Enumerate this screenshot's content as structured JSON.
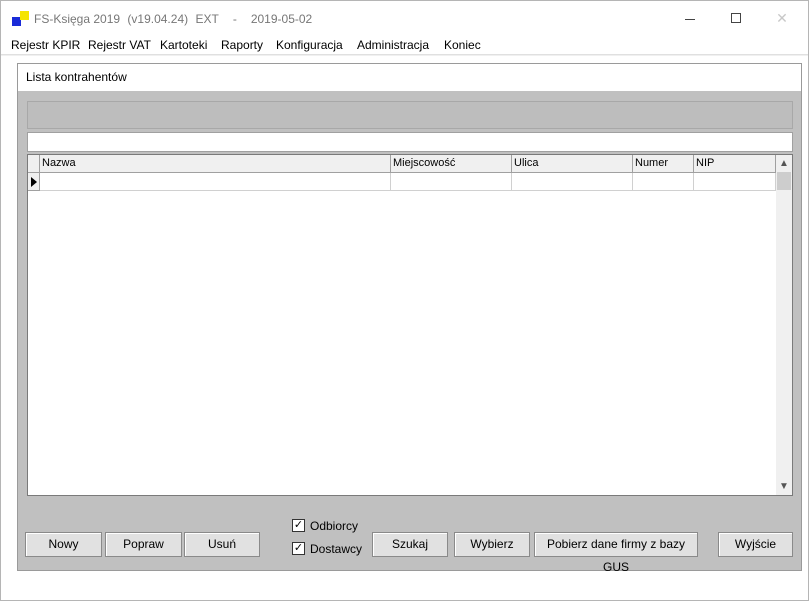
{
  "window": {
    "app_name": "FS-Księga 2019",
    "version": "(v19.04.24)",
    "edition": "EXT",
    "separator": "-",
    "date": "2019-05-02",
    "minimize_icon": "minimize-icon",
    "maximize_icon": "maximize-icon",
    "close_glyph": "✕"
  },
  "menu": {
    "items": [
      "Rejestr KPIR",
      "Rejestr VAT",
      "Kartoteki",
      "Raporty",
      "Konfiguracja",
      "Administracja",
      "Koniec"
    ]
  },
  "dialog": {
    "title": "Lista kontrahentów"
  },
  "grid": {
    "columns": [
      "Nazwa",
      "Miejscowość",
      "Ulica",
      "Numer",
      "NIP"
    ],
    "rows": [
      [
        "",
        "",
        "",
        "",
        ""
      ]
    ],
    "scroll_up_glyph": "▲",
    "scroll_down_glyph": "▼"
  },
  "buttons": {
    "new": "Nowy",
    "edit": "Popraw",
    "delete": "Usuń",
    "search": "Szukaj",
    "select": "Wybierz",
    "gus": "Pobierz dane firmy z bazy GUS",
    "exit": "Wyjście"
  },
  "filters": {
    "recipients": {
      "label": "Odbiorcy",
      "checked": true,
      "mark": "✓"
    },
    "suppliers": {
      "label": "Dostawcy",
      "checked": true,
      "mark": "✓"
    }
  },
  "colors": {
    "accent_blue": "#1a2bd8",
    "accent_yellow": "#f5e400"
  }
}
